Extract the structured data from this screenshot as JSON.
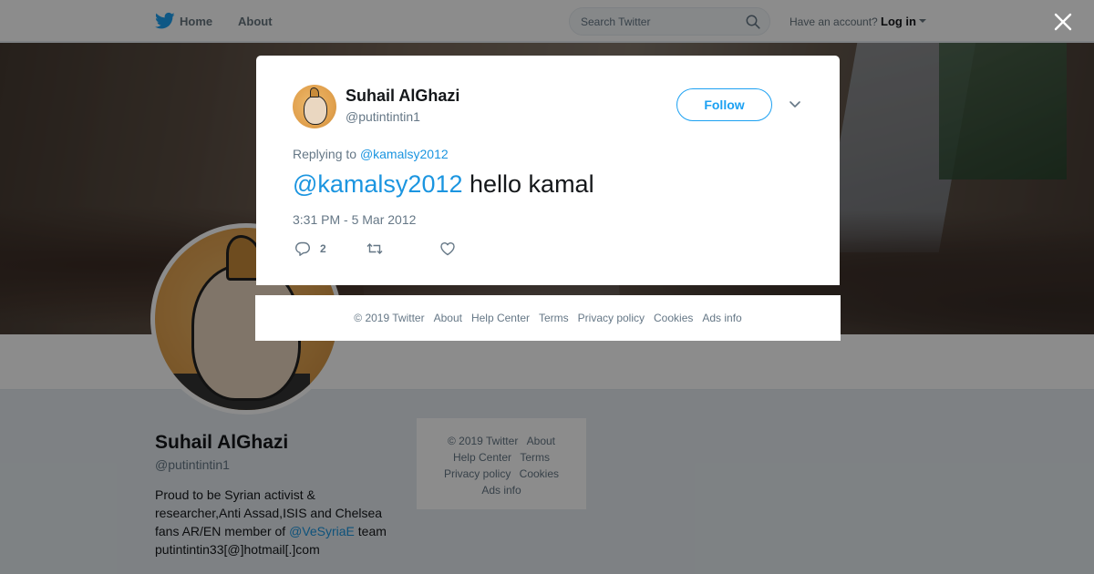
{
  "nav": {
    "home": "Home",
    "about": "About",
    "search_placeholder": "Search Twitter",
    "account_question": "Have an account?",
    "login": "Log in"
  },
  "profile": {
    "name": "Suhail AlGhazi",
    "handle": "@putintintin1",
    "bio_before_link": "Proud to be Syrian activist & researcher,Anti Assad,ISIS and Chelsea fans AR/EN member of ",
    "bio_link": "@VeSyriaE",
    "bio_after_link": " team putintintin33[@]hotmail[.]com"
  },
  "side_footer": {
    "copyright": "© 2019 Twitter",
    "about": "About",
    "help": "Help Center",
    "terms": "Terms",
    "privacy": "Privacy policy",
    "cookies": "Cookies",
    "ads": "Ads info"
  },
  "tweet": {
    "author_name": "Suhail AlGhazi",
    "author_handle": "@putintintin1",
    "follow_label": "Follow",
    "replying_prefix": "Replying to",
    "replying_to": "@kamalsy2012",
    "mention": "@kamalsy2012",
    "text": " hello kamal",
    "timestamp": "3:31 PM - 5 Mar 2012",
    "reply_count": "2"
  },
  "modal_footer": {
    "copyright": "© 2019 Twitter",
    "about": "About",
    "help": "Help Center",
    "terms": "Terms",
    "privacy": "Privacy policy",
    "cookies": "Cookies",
    "ads": "Ads info"
  },
  "colors": {
    "brand": "#1da1f2",
    "link": "#1b95e0",
    "muted": "#657786"
  }
}
